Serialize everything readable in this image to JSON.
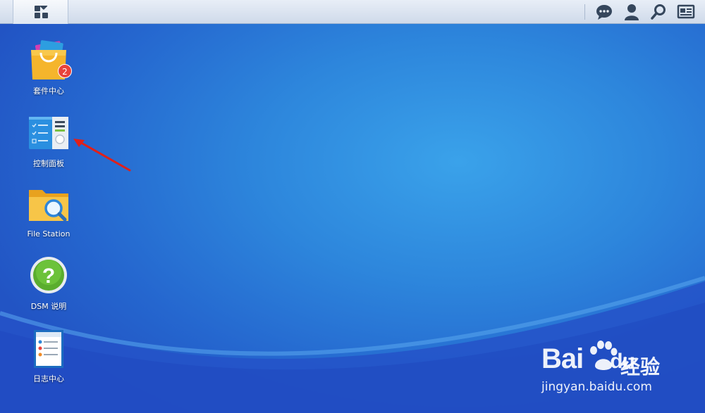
{
  "taskbar": {
    "main_menu_icon": "grid-icon",
    "right_icons": [
      "chat-icon",
      "user-icon",
      "search-icon",
      "widgets-icon"
    ]
  },
  "desktop": {
    "apps": [
      {
        "label": "套件中心",
        "icon": "package-center-icon",
        "badge": "2"
      },
      {
        "label": "控制面板",
        "icon": "control-panel-icon"
      },
      {
        "label": "File Station",
        "icon": "file-station-icon"
      },
      {
        "label": "DSM 说明",
        "icon": "help-icon"
      },
      {
        "label": "日志中心",
        "icon": "log-center-icon"
      }
    ]
  },
  "watermark": {
    "brand": "Bai",
    "brand_tail": "du",
    "cn": "经验",
    "url": "jingyan.baidu.com"
  },
  "colors": {
    "desktop": "#2d86dc",
    "badge": "#e8433c",
    "arrow": "#e0201a"
  }
}
